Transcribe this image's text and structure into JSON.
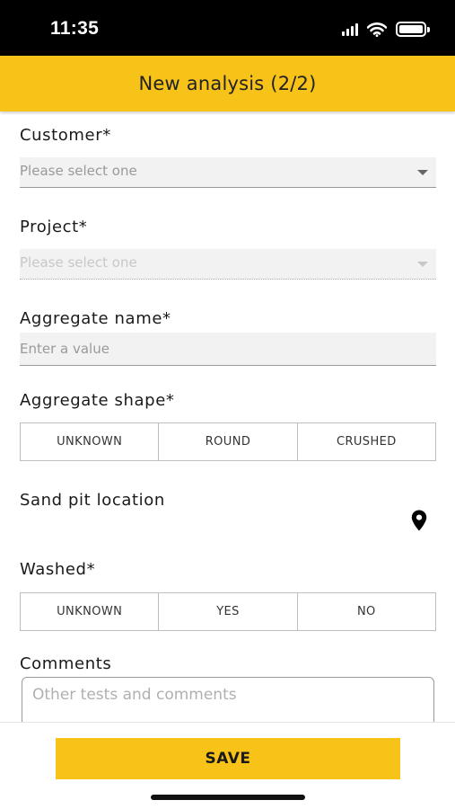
{
  "status_bar": {
    "time": "11:35",
    "icons": [
      "cellular-signal-icon",
      "wifi-icon",
      "battery-icon"
    ]
  },
  "header": {
    "title": "New analysis (2/2)"
  },
  "colors": {
    "accent": "#f8c318",
    "status_bar": "#000000"
  },
  "form": {
    "customer": {
      "label": "Customer*",
      "placeholder": "Please select one"
    },
    "project": {
      "label": "Project*",
      "placeholder": "Please select one",
      "disabled": true
    },
    "aggregate_name": {
      "label": "Aggregate name*",
      "placeholder": "Enter a value"
    },
    "aggregate_shape": {
      "label": "Aggregate shape*",
      "options": [
        "UNKNOWN",
        "ROUND",
        "CRUSHED"
      ]
    },
    "sand_pit_location": {
      "label": "Sand pit location",
      "icon": "map-pin-icon"
    },
    "washed": {
      "label": "Washed*",
      "options": [
        "UNKNOWN",
        "YES",
        "NO"
      ]
    },
    "comments": {
      "label": "Comments",
      "placeholder": "Other tests and comments"
    }
  },
  "footer": {
    "save_label": "SAVE"
  }
}
